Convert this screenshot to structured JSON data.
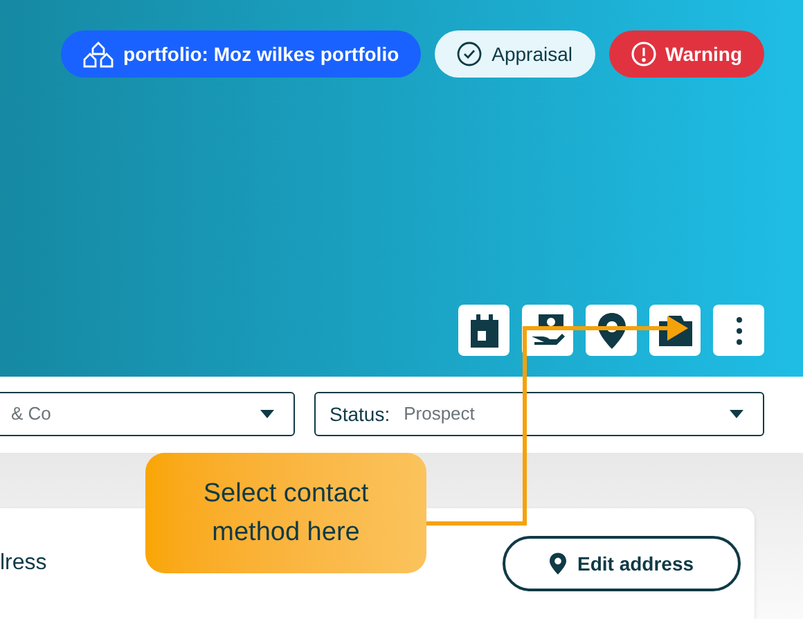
{
  "badges": [
    {
      "kind": "portfolio",
      "label": "portfolio: Moz wilkes portfolio"
    },
    {
      "kind": "appraisal",
      "label": "Appraisal"
    },
    {
      "kind": "warning",
      "label": "Warning"
    }
  ],
  "dropdowns": [
    {
      "value": "& Co"
    },
    {
      "label": "Status:",
      "value": "Prospect"
    }
  ],
  "card": {
    "title": "lress",
    "button": "Edit address"
  },
  "callout": {
    "text": "Select contact method here"
  }
}
